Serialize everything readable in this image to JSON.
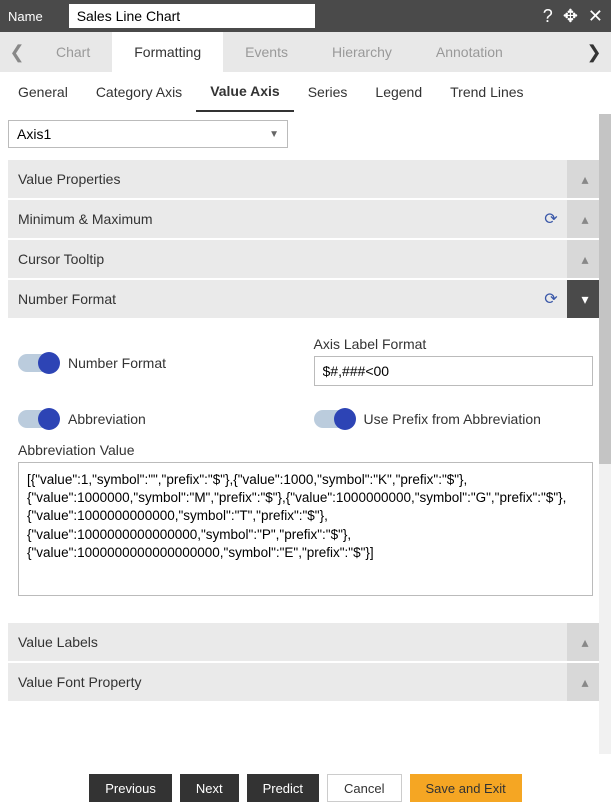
{
  "header": {
    "name_label": "Name",
    "name_value": "Sales Line Chart"
  },
  "tabs": {
    "items": [
      "Chart",
      "Formatting",
      "Events",
      "Hierarchy",
      "Annotation"
    ],
    "active": 1
  },
  "subtabs": {
    "items": [
      "General",
      "Category Axis",
      "Value Axis",
      "Series",
      "Legend",
      "Trend Lines"
    ],
    "active": 2
  },
  "dropdown": {
    "value": "Axis1"
  },
  "panels": {
    "value_properties": "Value Properties",
    "min_max": "Minimum & Maximum",
    "cursor_tooltip": "Cursor Tooltip",
    "number_format": "Number Format",
    "value_labels": "Value Labels",
    "value_font": "Value Font Property"
  },
  "nf": {
    "number_format_toggle": "Number Format",
    "axis_label_format": "Axis Label Format",
    "axis_label_value": "$#,###<00",
    "abbreviation_toggle": "Abbreviation",
    "prefix_toggle": "Use Prefix from Abbreviation",
    "abbr_value_label": "Abbreviation Value",
    "abbr_value_text": "[{\"value\":1,\"symbol\":\"\",\"prefix\":\"$\"},{\"value\":1000,\"symbol\":\"K\",\"prefix\":\"$\"},{\"value\":1000000,\"symbol\":\"M\",\"prefix\":\"$\"},{\"value\":1000000000,\"symbol\":\"G\",\"prefix\":\"$\"},{\"value\":1000000000000,\"symbol\":\"T\",\"prefix\":\"$\"},{\"value\":1000000000000000,\"symbol\":\"P\",\"prefix\":\"$\"},{\"value\":1000000000000000000,\"symbol\":\"E\",\"prefix\":\"$\"}]"
  },
  "footer": {
    "previous": "Previous",
    "next": "Next",
    "predict": "Predict",
    "cancel": "Cancel",
    "save": "Save and Exit"
  }
}
